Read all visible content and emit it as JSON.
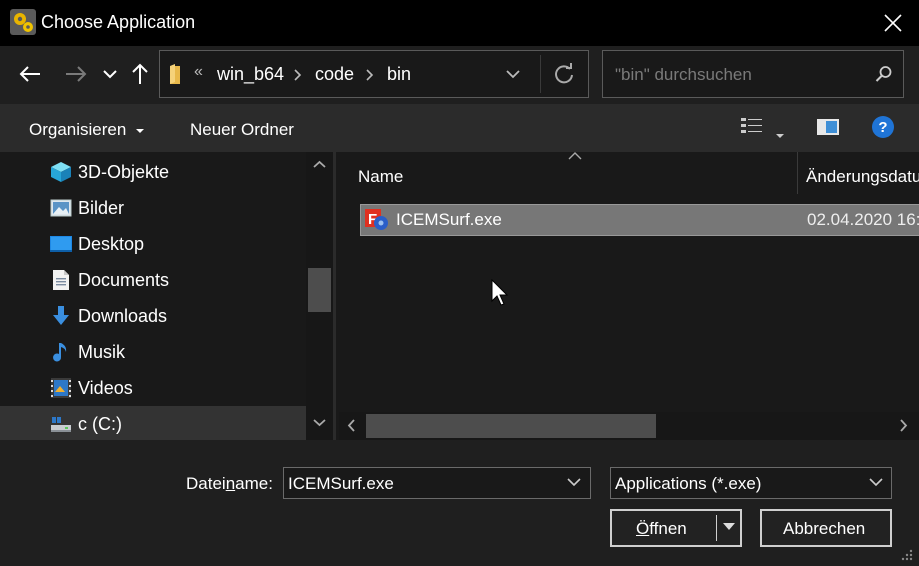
{
  "window": {
    "title": "Choose Application"
  },
  "address": {
    "overflow": "«",
    "crumbs": [
      "win_b64",
      "code",
      "bin"
    ]
  },
  "search": {
    "placeholder": "\"bin\" durchsuchen"
  },
  "toolbar": {
    "organize": "Organisieren",
    "new_folder": "Neuer Ordner"
  },
  "sidebar": {
    "items": [
      {
        "label": "3D-Objekte",
        "icon": "cube-icon"
      },
      {
        "label": "Bilder",
        "icon": "pictures-icon"
      },
      {
        "label": "Desktop",
        "icon": "desktop-icon"
      },
      {
        "label": "Documents",
        "icon": "document-icon"
      },
      {
        "label": "Downloads",
        "icon": "download-icon"
      },
      {
        "label": "Musik",
        "icon": "music-icon"
      },
      {
        "label": "Videos",
        "icon": "video-icon"
      },
      {
        "label": "c (C:)",
        "icon": "drive-icon",
        "selected": true
      }
    ]
  },
  "filelist": {
    "columns": {
      "name": "Name",
      "date": "Änderungsdatum"
    },
    "files": [
      {
        "name": "ICEMSurf.exe",
        "date": "02.04.2020 16:"
      }
    ]
  },
  "footer": {
    "filename_label_pre": "Datei",
    "filename_label_u": "n",
    "filename_label_post": "ame:",
    "filename_value": "ICEMSurf.exe",
    "filetype_value": "Applications (*.exe)",
    "open_pre": "",
    "open_u": "Ö",
    "open_post": "ffnen",
    "cancel": "Abbrechen"
  }
}
